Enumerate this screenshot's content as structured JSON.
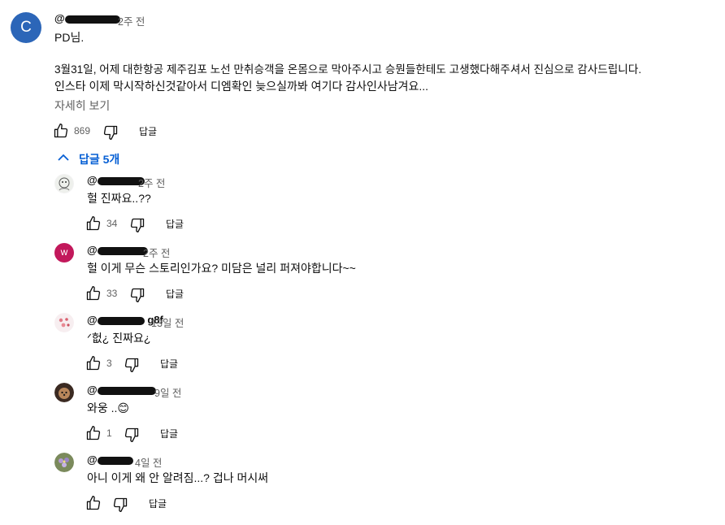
{
  "main_comment": {
    "avatar_letter": "C",
    "handle": "@",
    "time": "2주 전",
    "lines": [
      "PD님.",
      "",
      "3월31일, 어제 대한항공 제주김포 노선 만취승객을 온몸으로 막아주시고 승뭔들한테도 고생했다해주셔서 진심으로 감사드립니다.",
      "인스타 이제 막시작하신것같아서 디엠확인 늦으실까봐 여기다 감사인사남겨요..."
    ],
    "read_more": "자세히 보기",
    "likes": "869",
    "reply_label": "답글"
  },
  "replies_toggle": "답글 5개",
  "replies": [
    {
      "handle": "@",
      "time": "2주 전",
      "text": "헐 진짜요..??",
      "likes": "34",
      "reply_label": "답글",
      "avatar": "sketch"
    },
    {
      "handle": "@",
      "time": "2주 전",
      "text": "헐 이게 무슨 스토리인가요? 미담은 널리 퍼져야합니다~~",
      "likes": "33",
      "reply_label": "답글",
      "avatar": "w",
      "avatar_letter": "w"
    },
    {
      "handle": "@",
      "handle_suffix": "g8f",
      "time": "13일 전",
      "text": "ᐟ헚¿ 진짜요¿",
      "likes": "3",
      "reply_label": "답글",
      "avatar": "pink"
    },
    {
      "handle": "@",
      "time": "9일 전",
      "text": "와웅 ..😊",
      "likes": "1",
      "reply_label": "답글",
      "avatar": "dog"
    },
    {
      "handle": "@",
      "time": "4일 전",
      "text": "아니 이게 왜 안 알려짐...? 겁나 머시써",
      "likes": "",
      "reply_label": "답글",
      "avatar": "flower"
    }
  ],
  "colors": {
    "accent_link": "#065fd4",
    "main_avatar": "#2c66b8",
    "w_avatar": "#c2185b"
  }
}
